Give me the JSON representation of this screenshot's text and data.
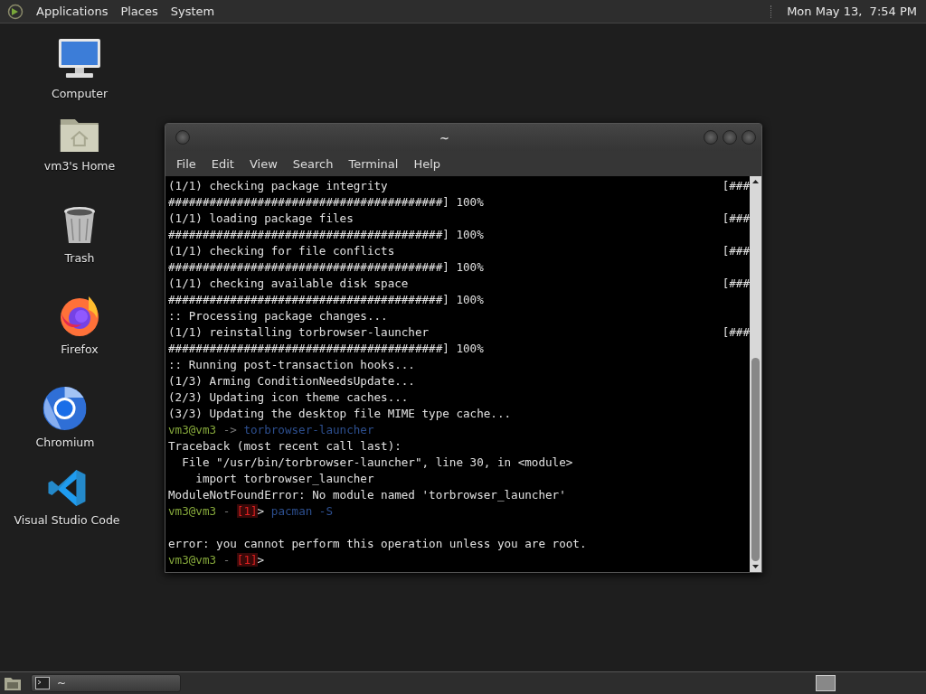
{
  "top_panel": {
    "menus": [
      "Applications",
      "Places",
      "System"
    ],
    "clock": "Mon May 13,  7:54 PM"
  },
  "desktop_icons": [
    {
      "label": "Computer",
      "kind": "computer"
    },
    {
      "label": "vm3's Home",
      "kind": "home"
    },
    {
      "label": "Trash",
      "kind": "trash"
    },
    {
      "label": "Firefox",
      "kind": "firefox"
    },
    {
      "label": "Chromium",
      "kind": "chromium"
    },
    {
      "label": "Visual Studio Code",
      "kind": "vscode"
    }
  ],
  "window": {
    "title": "~",
    "menu": [
      "File",
      "Edit",
      "View",
      "Search",
      "Terminal",
      "Help"
    ],
    "lines": [
      {
        "kind": "progress",
        "text": "(1/1) checking package integrity",
        "right": "[###"
      },
      {
        "kind": "output",
        "text": "########################################] 100%"
      },
      {
        "kind": "progress",
        "text": "(1/1) loading package files",
        "right": "[###"
      },
      {
        "kind": "output",
        "text": "########################################] 100%"
      },
      {
        "kind": "progress",
        "text": "(1/1) checking for file conflicts",
        "right": "[###"
      },
      {
        "kind": "output",
        "text": "########################################] 100%"
      },
      {
        "kind": "progress",
        "text": "(1/1) checking available disk space",
        "right": "[###"
      },
      {
        "kind": "output",
        "text": "########################################] 100%"
      },
      {
        "kind": "output",
        "text": ":: Processing package changes..."
      },
      {
        "kind": "progress",
        "text": "(1/1) reinstalling torbrowser-launcher",
        "right": "[###"
      },
      {
        "kind": "output",
        "text": "########################################] 100%"
      },
      {
        "kind": "output",
        "text": ":: Running post-transaction hooks..."
      },
      {
        "kind": "output",
        "text": "(1/3) Arming ConditionNeedsUpdate..."
      },
      {
        "kind": "output",
        "text": "(2/3) Updating icon theme caches..."
      },
      {
        "kind": "output",
        "text": "(3/3) Updating the desktop file MIME type cache..."
      },
      {
        "kind": "prompt",
        "user": "vm3@vm3",
        "separator": "->",
        "command": "torbrowser-launcher"
      },
      {
        "kind": "output",
        "text": "Traceback (most recent call last):"
      },
      {
        "kind": "output",
        "text": "  File \"/usr/bin/torbrowser-launcher\", line 30, in <module>"
      },
      {
        "kind": "output",
        "text": "    import torbrowser_launcher"
      },
      {
        "kind": "output",
        "text": "ModuleNotFoundError: No module named 'torbrowser_launcher'"
      },
      {
        "kind": "prompt",
        "user": "vm3@vm3",
        "separator": "-",
        "status": "[1]",
        "arrow": ">",
        "command": "pacman -S"
      },
      {
        "kind": "blank"
      },
      {
        "kind": "output",
        "text": "error: you cannot perform this operation unless you are root."
      },
      {
        "kind": "prompt",
        "user": "vm3@vm3",
        "separator": "-",
        "status": "[1]",
        "arrow": ">"
      }
    ]
  },
  "bottom_panel": {
    "tasks": [
      {
        "label": "~",
        "selected": false
      }
    ]
  }
}
